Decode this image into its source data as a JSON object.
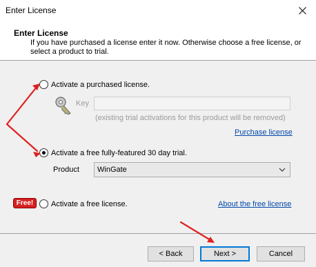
{
  "window": {
    "title": "Enter License"
  },
  "header": {
    "title": "Enter License",
    "description": "If you have purchased a license enter it now. Otherwise choose a free license, or select a product to trial."
  },
  "options": {
    "purchased": {
      "label": "Activate a purchased license.",
      "selected": false
    },
    "key": {
      "label": "Key",
      "value": "",
      "note": "(existing trial activations for this product will be removed)"
    },
    "purchase_link": "Purchase license",
    "trial": {
      "label": "Activate a free fully-featured 30 day trial.",
      "selected": true
    },
    "product": {
      "label": "Product",
      "value": "WinGate"
    },
    "free": {
      "badge": "Free!",
      "label": "Activate a free license.",
      "selected": false
    },
    "free_link": "About the free license"
  },
  "buttons": {
    "back": "< Back",
    "next": "Next >",
    "cancel": "Cancel"
  },
  "colors": {
    "annotation_arrow": "#e02020",
    "link": "#0047ab",
    "free_badge": "#d62020",
    "default_button_border": "#0078d7"
  }
}
